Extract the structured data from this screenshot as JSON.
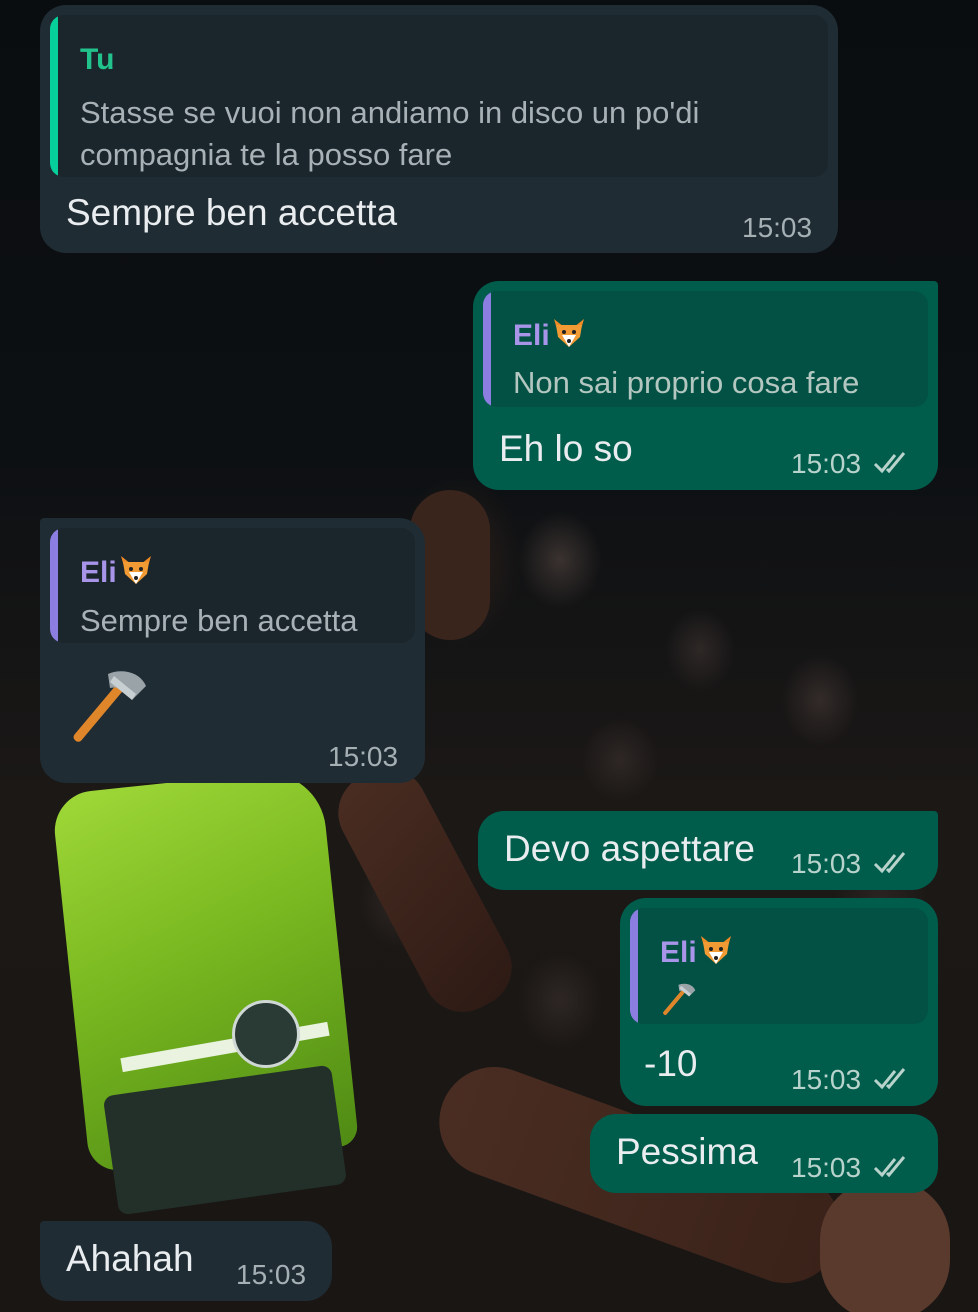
{
  "messages": [
    {
      "id": "m1",
      "direction": "incoming",
      "quote": {
        "author": "Tu",
        "text": "Stasse se vuoi non andiamo in disco un po'di compagnia te la posso fare"
      },
      "text": "Sempre ben accetta",
      "time": "15:03"
    },
    {
      "id": "m2",
      "direction": "outgoing",
      "quote": {
        "author": "Eli",
        "author_emoji": "fox-face-icon",
        "text": "Non sai proprio cosa fare"
      },
      "text": "Eh lo so",
      "time": "15:03",
      "status": "read"
    },
    {
      "id": "m3",
      "direction": "incoming",
      "quote": {
        "author": "Eli",
        "author_emoji": "fox-face-icon",
        "text": "Sempre ben accetta"
      },
      "emoji": "axe-icon",
      "time": "15:03"
    },
    {
      "id": "m4",
      "direction": "outgoing",
      "text": "Devo aspettare",
      "time": "15:03",
      "status": "read"
    },
    {
      "id": "m5",
      "direction": "outgoing",
      "quote": {
        "author": "Eli",
        "author_emoji": "fox-face-icon",
        "emoji": "axe-icon"
      },
      "text": "-10",
      "time": "15:03",
      "status": "read"
    },
    {
      "id": "m6",
      "direction": "outgoing",
      "text": "Pessima",
      "time": "15:03",
      "status": "read"
    },
    {
      "id": "m7",
      "direction": "incoming",
      "text": "Ahahah",
      "time": "15:03"
    }
  ],
  "colors": {
    "incoming_bubble": "#1f2c33",
    "outgoing_bubble": "#005c4b",
    "read_ticks": "#b8d3cc",
    "quote_bar_self": "#06cf9c",
    "quote_bar_other": "#8b7ee0"
  }
}
